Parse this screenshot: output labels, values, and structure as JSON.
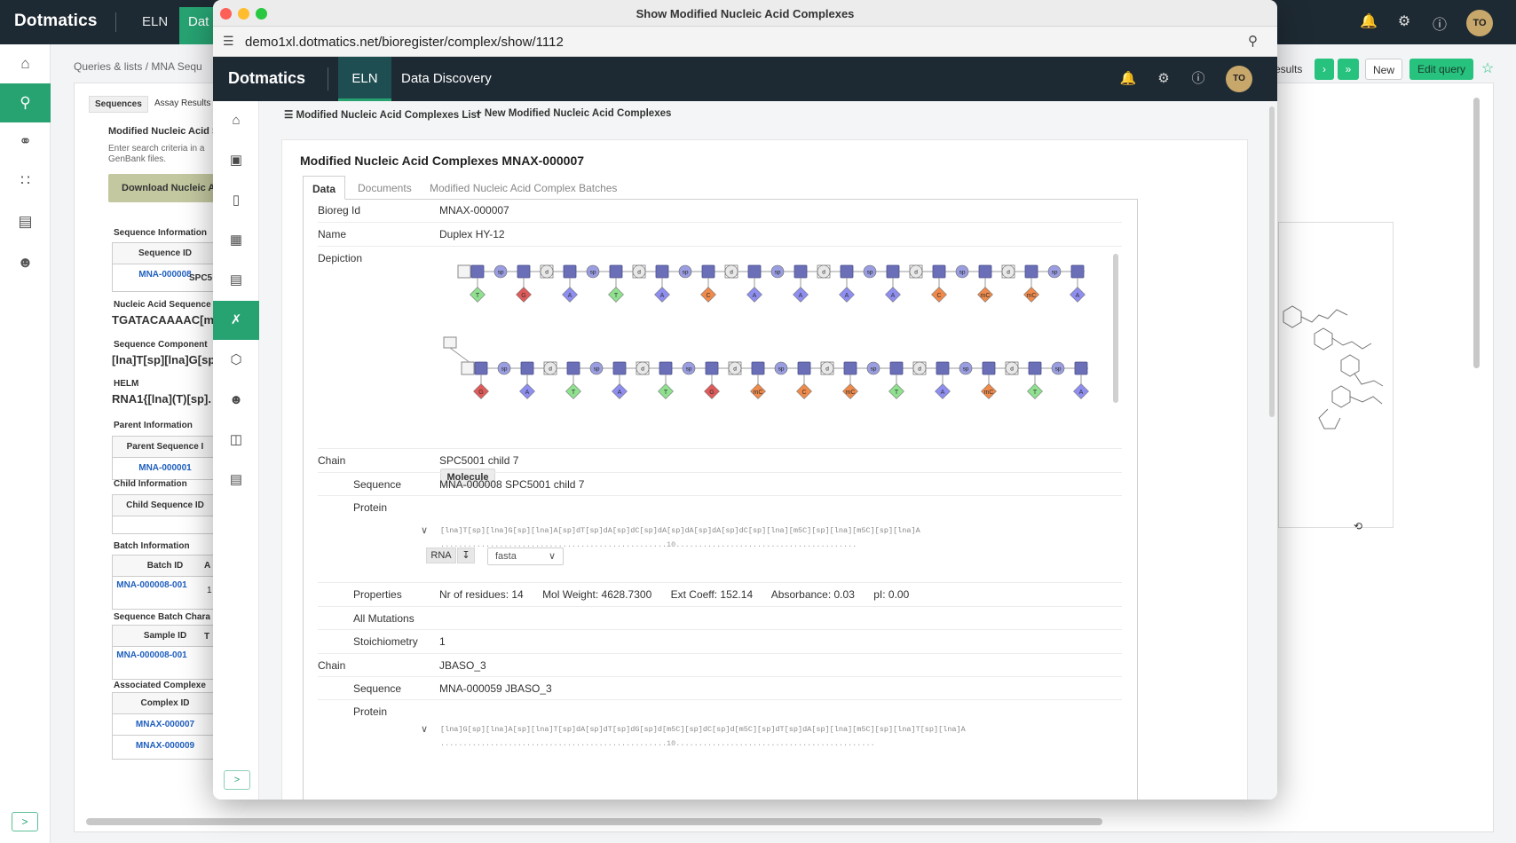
{
  "background": {
    "logo": "Dotmatics",
    "nav_eln": "ELN",
    "nav_data": "Dat",
    "avatar": "TO",
    "breadcrumb": "Queries & lists  /  MNA Sequ",
    "toolbar": {
      "results": "esults",
      "new": "New",
      "edit_query": "Edit query"
    },
    "tabs": [
      "Sequences",
      "Assay Results"
    ],
    "left_panel": {
      "title": "Modified Nucleic Acid S",
      "hint1": "Enter search criteria in a",
      "hint2": "GenBank files.",
      "download": "Download Nucleic A",
      "seq_info": "Sequence Information",
      "seq_id_header": "Sequence ID",
      "seq_id_value": "MNA-000008",
      "spc": "SPC5",
      "na_seq_label": "Nucleic Acid Sequence",
      "na_seq_value": "TGATACAAAAC[m",
      "seq_comp_label": "Sequence Component",
      "seq_comp_value": "[lna]T[sp][lna]G[sp",
      "helm_label": "HELM",
      "helm_value": "RNA1{[lna](T)[sp].",
      "parent_label": "Parent Information",
      "parent_header": "Parent Sequence I",
      "parent_value": "MNA-000001",
      "child_label": "Child Information",
      "child_header": "Child Sequence ID",
      "batch_label": "Batch Information",
      "batch_header": "Batch ID",
      "batch_col2": "A",
      "batch_value": "MNA-000008-001",
      "batch_num": "1",
      "sbc_label": "Sequence Batch Chara",
      "sample_header": "Sample ID",
      "sample_col2": "T",
      "sample_value": "MNA-000008-001",
      "assoc_label": "Associated Complexe",
      "complex_header": "Complex ID",
      "complex_1": "MNAX-000007",
      "complex_2": "MNAX-000009"
    }
  },
  "window": {
    "title": "Show Modified Nucleic Acid Complexes",
    "url": "demo1xl.dotmatics.net/bioregister/complex/show/1112"
  },
  "app": {
    "logo": "Dotmatics",
    "nav_eln": "ELN",
    "nav_data_discovery": "Data Discovery",
    "avatar": "TO",
    "link_list": "Modified Nucleic Acid Complexes List",
    "link_new": "New Modified Nucleic Acid Complexes",
    "card_title": "Modified Nucleic Acid Complexes MNAX-000007",
    "tabs": [
      "Data",
      "Documents",
      "Modified Nucleic Acid Complex Batches"
    ],
    "fields": {
      "bioreg_id_label": "Bioreg Id",
      "bioreg_id": "MNAX-000007",
      "name_label": "Name",
      "name": "Duplex HY-12",
      "depiction_label": "Depiction",
      "molecule_button": "Molecule",
      "chain1_label": "Chain",
      "chain1": "SPC5001 child 7",
      "seq1_label": "Sequence",
      "seq1": "MNA-000008 SPC5001 child 7",
      "protein1_label": "Protein",
      "seq1_text": "[lna]T[sp][lna]G[sp][lna]A[sp]dT[sp]dA[sp]dC[sp]dA[sp]dA[sp]dA[sp]dC[sp][lna][m5C][sp][lna][m5C][sp][lna]A",
      "seq1_ruler": "..................................................10........................................",
      "rna_button": "RNA",
      "format_select": "fasta",
      "properties_label": "Properties",
      "prop_residues": "Nr of residues: 14",
      "prop_mw": "Mol Weight: 4628.7300",
      "prop_ext": "Ext Coeff: 152.14",
      "prop_abs": "Absorbance: 0.03",
      "prop_pi": "pI: 0.00",
      "mutations_label": "All Mutations",
      "stoich_label": "Stoichiometry",
      "stoich": "1",
      "chain2_label": "Chain",
      "chain2": "JBASO_3",
      "seq2_label": "Sequence",
      "seq2": "MNA-000059 JBASO_3",
      "protein2_label": "Protein",
      "seq2_text": "[lna]G[sp][lna]A[sp][lna]T[sp]dA[sp]dT[sp]dG[sp]d[m5C][sp]dC[sp]d[m5C][sp]dT[sp]dA[sp][lna][m5C][sp][lna]T[sp][lna]A",
      "seq2_ruler": "..................................................10............................................"
    }
  },
  "depiction": {
    "strand1_bases": [
      "T",
      "G",
      "A",
      "T",
      "A",
      "C",
      "A",
      "A",
      "A",
      "A",
      "C",
      "mC",
      "mC",
      "A"
    ],
    "strand2_bases": [
      "G",
      "A",
      "T",
      "A",
      "T",
      "G",
      "mC",
      "C",
      "mC",
      "T",
      "A",
      "mC",
      "T",
      "A"
    ],
    "base_colors": {
      "T": "#8fe08f",
      "G": "#e05a5a",
      "A": "#8e8ef0",
      "C": "#f08a4b",
      "mC": "#f08a4b"
    },
    "sugar_color": "#6a6fb8",
    "linker_labels": [
      "sp",
      "d"
    ]
  }
}
